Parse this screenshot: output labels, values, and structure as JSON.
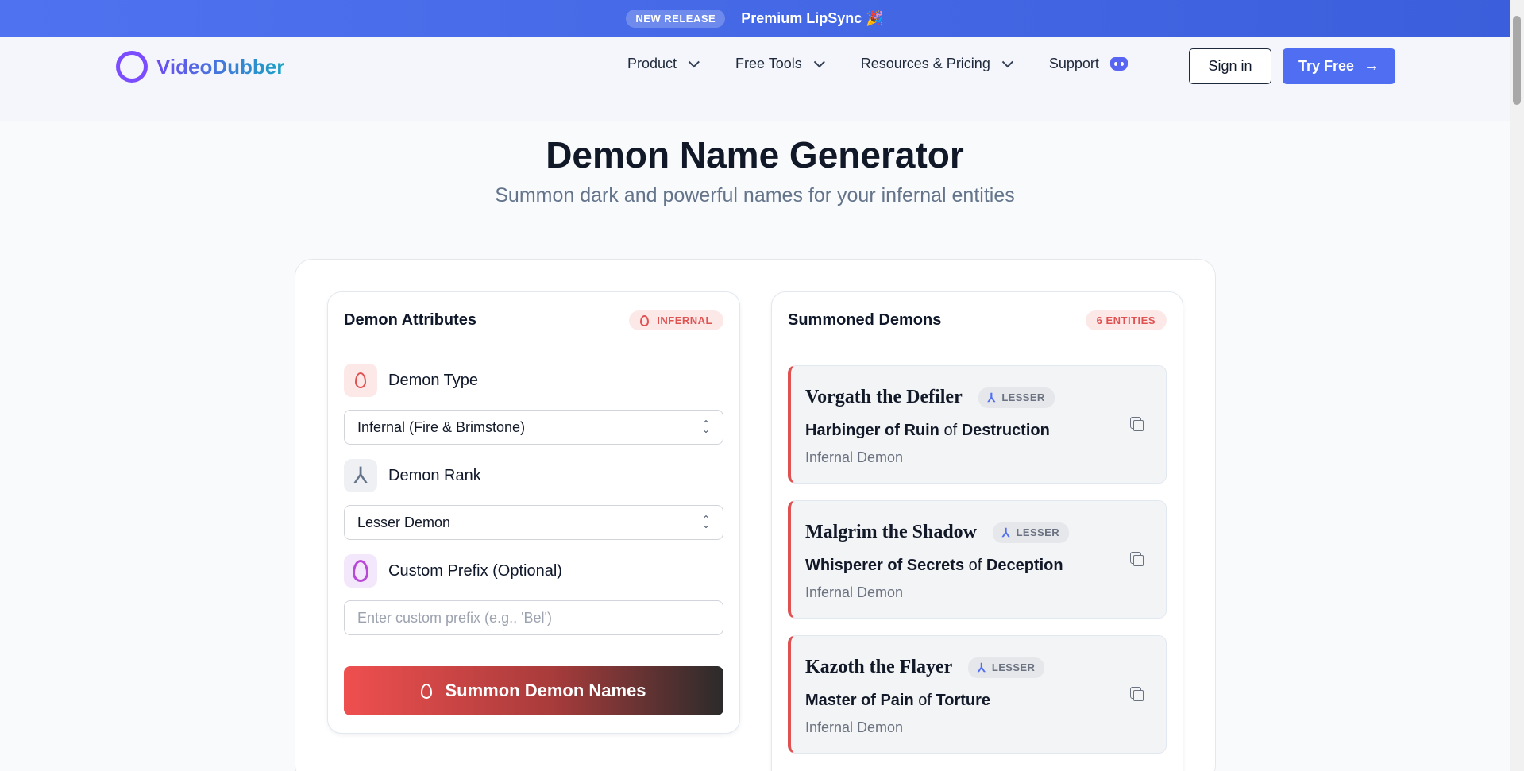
{
  "banner": {
    "badge": "NEW RELEASE",
    "promo": "Premium LipSync 🎉"
  },
  "header": {
    "logo": "VideoDubber",
    "nav": [
      {
        "label": "Product"
      },
      {
        "label": "Free Tools"
      },
      {
        "label": "Resources & Pricing"
      }
    ],
    "support": "Support",
    "signin": "Sign in",
    "try_free": "Try Free",
    "try_arrow": "→"
  },
  "hero": {
    "title": "Demon Name Generator",
    "subtitle": "Summon dark and powerful names for your infernal entities"
  },
  "attributes": {
    "title": "Demon Attributes",
    "tag": "INFERNAL",
    "type_label": "Demon Type",
    "type_value": "Infernal (Fire & Brimstone)",
    "rank_label": "Demon Rank",
    "rank_value": "Lesser Demon",
    "prefix_label": "Custom Prefix (Optional)",
    "prefix_placeholder": "Enter custom prefix (e.g., 'Bel')",
    "button": "Summon Demon Names"
  },
  "results": {
    "title": "Summoned Demons",
    "count_badge": "6 ENTITIES",
    "demons": [
      {
        "name": "Vorgath the Defiler",
        "rank": "LESSER",
        "role": "Harbinger of Ruin",
        "of": "of",
        "domain": "Destruction",
        "type": "Infernal Demon"
      },
      {
        "name": "Malgrim the Shadow",
        "rank": "LESSER",
        "role": "Whisperer of Secrets",
        "of": "of",
        "domain": "Deception",
        "type": "Infernal Demon"
      },
      {
        "name": "Kazoth the Flayer",
        "rank": "LESSER",
        "role": "Master of Pain",
        "of": "of",
        "domain": "Torture",
        "type": "Infernal Demon"
      }
    ]
  },
  "colors": {
    "accent": "#4f6ef2",
    "infernal_red": "#e05252",
    "logo_purple": "#7c4dff"
  },
  "icons": {
    "flame": "flame-icon",
    "rank": "rank-icon",
    "copy": "copy-icon",
    "chevron": "chevron-down-icon",
    "discord": "discord-icon"
  }
}
